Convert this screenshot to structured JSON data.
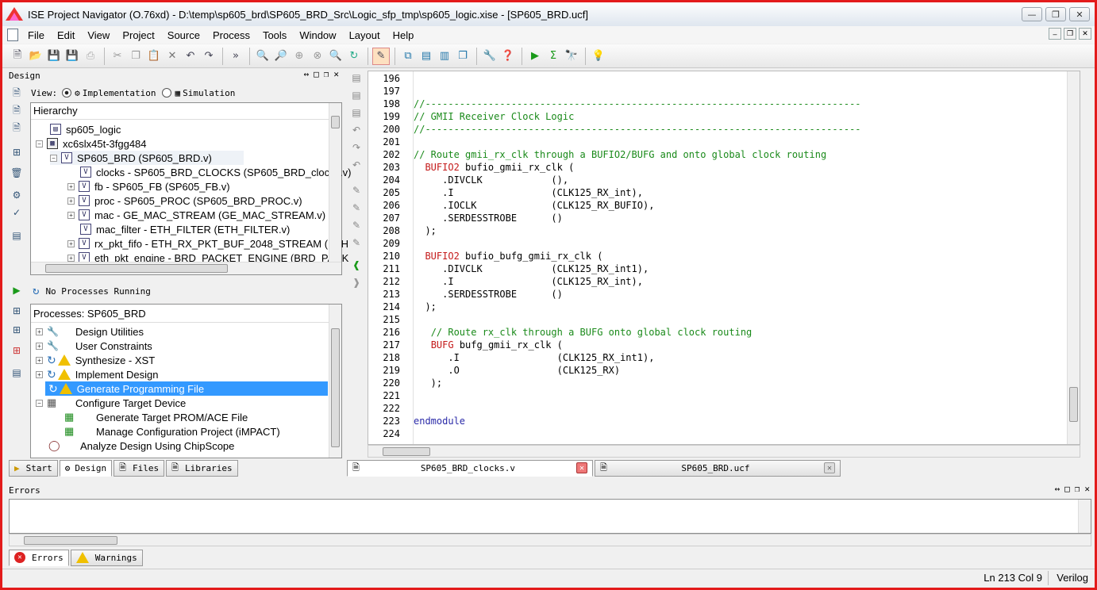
{
  "window": {
    "title": "ISE Project Navigator (O.76xd) - D:\\temp\\sp605_brd\\SP605_BRD_Src\\Logic_sfp_tmp\\sp605_logic.xise - [SP605_BRD.ucf]"
  },
  "menu": [
    "File",
    "Edit",
    "View",
    "Project",
    "Source",
    "Process",
    "Tools",
    "Window",
    "Layout",
    "Help"
  ],
  "design_panel": {
    "title": "Design",
    "view_label": "View:",
    "impl_label": "Implementation",
    "sim_label": "Simulation",
    "hierarchy_label": "Hierarchy",
    "tree": [
      {
        "label": "sp605_logic"
      },
      {
        "label": "xc6slx45t-3fgg484"
      },
      {
        "label": "SP605_BRD (SP605_BRD.v)"
      },
      {
        "label": "clocks - SP605_BRD_CLOCKS (SP605_BRD_clocks.v)"
      },
      {
        "label": "fb - SP605_FB (SP605_FB.v)"
      },
      {
        "label": "proc - SP605_PROC (SP605_BRD_PROC.v)"
      },
      {
        "label": "mac - GE_MAC_STREAM (GE_MAC_STREAM.v)"
      },
      {
        "label": "mac_filter - ETH_FILTER (ETH_FILTER.v)"
      },
      {
        "label": "rx_pkt_fifo - ETH_RX_PKT_BUF_2048_STREAM (ETH"
      },
      {
        "label": "eth_pkt_engine - BRD_PACKET_ENGINE (BRD_PACK"
      }
    ],
    "no_processes": "No Processes Running",
    "processes_label": "Processes: SP605_BRD",
    "processes": [
      {
        "label": "Design Utilities"
      },
      {
        "label": "User Constraints"
      },
      {
        "label": "Synthesize - XST"
      },
      {
        "label": "Implement Design"
      },
      {
        "label": "Generate Programming File"
      },
      {
        "label": "Configure Target Device"
      },
      {
        "label": "Generate Target PROM/ACE File"
      },
      {
        "label": "Manage Configuration Project (iMPACT)"
      },
      {
        "label": "Analyze Design Using ChipScope"
      }
    ],
    "bottom_tabs": [
      "Start",
      "Design",
      "Files",
      "Libraries"
    ]
  },
  "editor": {
    "lines": [
      {
        "n": "196",
        "html": ""
      },
      {
        "n": "197",
        "html": ""
      },
      {
        "n": "198",
        "html": "<span class=\"cmt\">//----------------------------------------------------------------------------</span>"
      },
      {
        "n": "199",
        "html": "<span class=\"cmt\">// GMII Receiver Clock Logic</span>"
      },
      {
        "n": "200",
        "html": "<span class=\"cmt\">//----------------------------------------------------------------------------</span>"
      },
      {
        "n": "201",
        "html": ""
      },
      {
        "n": "202",
        "html": "<span class=\"cmt\">// Route gmii_rx_clk through a BUFIO2/BUFG and onto global clock routing</span>"
      },
      {
        "n": "203",
        "html": "  <span class=\"kw\">BUFIO2</span> bufio_gmii_rx_clk ("
      },
      {
        "n": "204",
        "html": "     .DIVCLK            (),"
      },
      {
        "n": "205",
        "html": "     .I                 (CLK125_RX_int),"
      },
      {
        "n": "206",
        "html": "     .IOCLK             (CLK125_RX_BUFIO),"
      },
      {
        "n": "207",
        "html": "     .SERDESSTROBE      ()"
      },
      {
        "n": "208",
        "html": "  );"
      },
      {
        "n": "209",
        "html": ""
      },
      {
        "n": "210",
        "html": "  <span class=\"kw\">BUFIO2</span> bufio_bufg_gmii_rx_clk ("
      },
      {
        "n": "211",
        "html": "     .DIVCLK            (CLK125_RX_int1),"
      },
      {
        "n": "212",
        "html": "     .I                 (CLK125_RX_int),"
      },
      {
        "n": "213",
        "html": "     .SERDESSTROBE      ()"
      },
      {
        "n": "214",
        "html": "  );"
      },
      {
        "n": "215",
        "html": ""
      },
      {
        "n": "216",
        "html": "   <span class=\"cmt\">// Route rx_clk through a BUFG onto global clock routing</span>"
      },
      {
        "n": "217",
        "html": "   <span class=\"kw\">BUFG</span> bufg_gmii_rx_clk ("
      },
      {
        "n": "218",
        "html": "      .I                 (CLK125_RX_int1),"
      },
      {
        "n": "219",
        "html": "      .O                 (CLK125_RX)"
      },
      {
        "n": "220",
        "html": "   );"
      },
      {
        "n": "221",
        "html": ""
      },
      {
        "n": "222",
        "html": ""
      },
      {
        "n": "223",
        "html": "<span class=\"kwb\">endmodule</span>"
      },
      {
        "n": "224",
        "html": ""
      }
    ],
    "tabs": [
      {
        "label": "SP605_BRD_clocks.v"
      },
      {
        "label": "SP605_BRD.ucf"
      }
    ]
  },
  "errors_panel": {
    "title": "Errors",
    "tabs": [
      "Errors",
      "Warnings"
    ]
  },
  "status": {
    "position": "Ln 213 Col 9",
    "language": "Verilog"
  }
}
